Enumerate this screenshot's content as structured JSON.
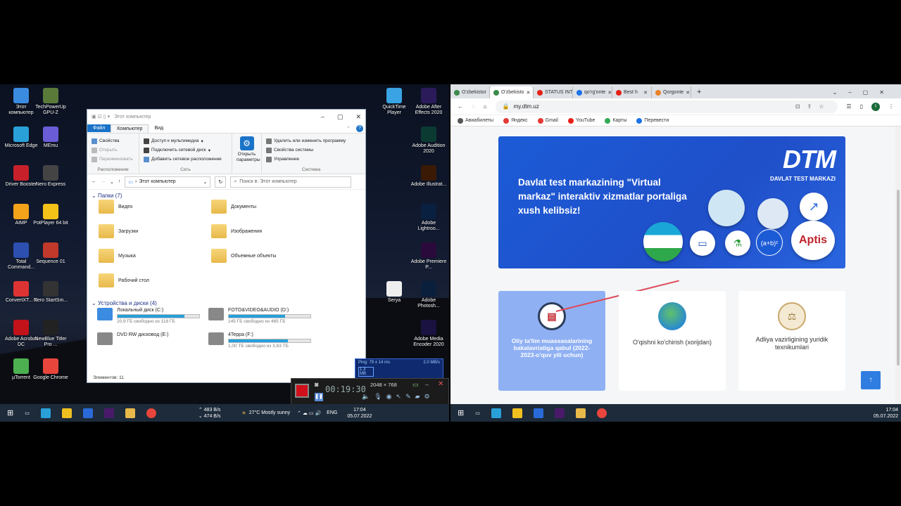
{
  "desktop": {
    "icons_left": [
      {
        "label": "Этот компьютер",
        "color": "#3b8be0"
      },
      {
        "label": "TechPowerUp GPU-Z",
        "color": "#5a7a3a"
      },
      {
        "label": "Microsoft Edge",
        "color": "#2aa0d8"
      },
      {
        "label": "MEmu",
        "color": "#6a5cd6"
      },
      {
        "label": "Driver Booster",
        "color": "#c8202a"
      },
      {
        "label": "Nero Express",
        "color": "#444"
      },
      {
        "label": "AIMP",
        "color": "#f2a31a"
      },
      {
        "label": "PotPlayer 64 bit",
        "color": "#f2c218"
      },
      {
        "label": "Total Command...",
        "color": "#2c4fb0"
      },
      {
        "label": "Sequence 01",
        "color": "#c0392b"
      },
      {
        "label": "ConvertXT... 7",
        "color": "#d33"
      },
      {
        "label": "Nero StartSm...",
        "color": "#333"
      },
      {
        "label": "Adobe Acrobat DC",
        "color": "#c2121a"
      },
      {
        "label": "NewBlue Titler Pro ...",
        "color": "#222"
      },
      {
        "label": "µTorrent",
        "color": "#4caf50"
      },
      {
        "label": "Google Chrome",
        "color": "#e8453c"
      }
    ],
    "icons_right": [
      {
        "label": "QuickTime Player",
        "color": "#3aa3e3"
      },
      {
        "label": "Adobe After Effects 2020",
        "color": "#2b1b5a"
      },
      {
        "label": "Adobe Audition 2020",
        "color": "#0b3a33"
      },
      {
        "label": "Adobe Illustrat...",
        "color": "#3b1a05"
      },
      {
        "label": "Adobe Lightroo...",
        "color": "#0a2040"
      },
      {
        "label": "Adobe Premiere P...",
        "color": "#2a0a3a"
      },
      {
        "label": "Serya",
        "color": "#eee"
      },
      {
        "label": "Adobe Photosh...",
        "color": "#0a1f3c"
      },
      {
        "label": "Adobe Media Encoder 2020",
        "color": "#1a1240"
      }
    ]
  },
  "explorer": {
    "title": "Этот компьютер",
    "tabs": {
      "file": "Файл",
      "computer": "Компьютер",
      "view": "Вид"
    },
    "ribbon": {
      "g1": [
        "Свойства",
        "Открыть",
        "Переименовать"
      ],
      "g1_label": "Расположение",
      "g2": [
        "Доступ к мультимедиа",
        "Подключить сетевой диск",
        "Добавить сетевое расположение"
      ],
      "g2_label": "Сеть",
      "open_params": "Открыть параметры",
      "g3": [
        "Удалить или изменить программу",
        "Свойства системы",
        "Управление"
      ],
      "g3_label": "Система"
    },
    "path": "Этот компьютер",
    "search_placeholder": "Поиск в: Этот компьютер",
    "folders_header": "Папки (7)",
    "folders": [
      "Видео",
      "Документы",
      "Загрузки",
      "Изображения",
      "Музыка",
      "Объемные объекты",
      "Рабочий стол"
    ],
    "drives_header": "Устройства и диски (4)",
    "drives": [
      {
        "name": "Локальный диск (C:)",
        "free": "20,9 ГБ свободно из 118 ГБ",
        "used_pct": 82
      },
      {
        "name": "FOTO&VIDEO&AUDIO (D:)",
        "free": "145 ГБ свободно из 465 ГБ",
        "used_pct": 69
      },
      {
        "name": "DVD RW дисковод (E:)",
        "free": "",
        "used_pct": 0
      },
      {
        "name": "4Tepра (F:)",
        "free": "1,00 ТБ свободно из 3,63 ТБ",
        "used_pct": 72
      }
    ],
    "status": "Элементов: 11"
  },
  "net_widget": {
    "ping": "Ping: 79 ± 14 ms",
    "speed": "2.0 MB/s",
    "size": "1.3 MB"
  },
  "recorder": {
    "time": "00:19:30",
    "resolution": "2048 × 768"
  },
  "taskbar_left": {
    "net_up": "483 B/s",
    "net_down": "474 B/s",
    "weather": "27°C  Mostly sunny",
    "lang": "ENG",
    "time": "17:04",
    "date": "05.07.2022"
  },
  "taskbar_right": {
    "time": "17:04",
    "date": "05.07.2022"
  },
  "browser": {
    "tabs": [
      "O'zbekistor",
      "O'zbekisto",
      "STATUS INT",
      "qo'rg'onte",
      "Best h",
      "Qorgonte"
    ],
    "active_tab": 1,
    "url": "my.dtm.uz",
    "bookmarks": [
      "Авиабилеты",
      "Яндекс",
      "Gmail",
      "YouTube",
      "Карты",
      "Перевести"
    ],
    "banner": {
      "text": "Davlat test markazining \"Virtual markaz\" interaktiv xizmatlar portaliga xush kelibsiz!",
      "logo": "DTM",
      "logo_sub": "DAVLAT TEST MARKAZI",
      "aptis": "Aptis",
      "ab": "(a+b)²"
    },
    "cards": [
      "Oliy ta'lim muassasalarining bakalavriatiga qabul (2022-2023-o'quv yili uchun)",
      "O'qishni ko'chirish (xorijdan)",
      "Adliya vazirligining yuridik texnikumlari"
    ],
    "up_icon": "↑"
  }
}
